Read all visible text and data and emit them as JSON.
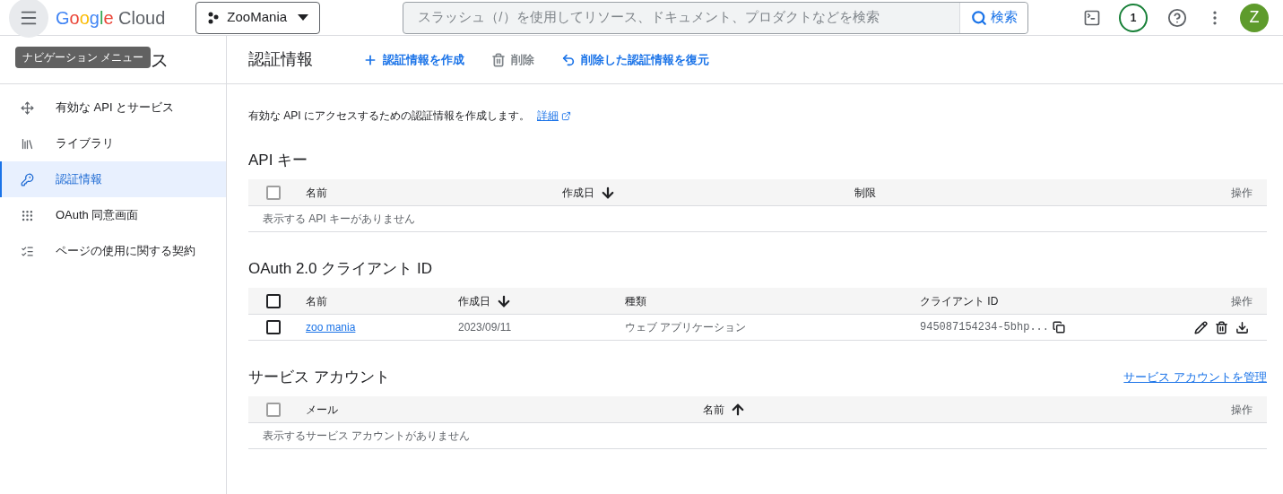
{
  "topbar": {
    "product_name": "Google Cloud",
    "project": "ZooMania",
    "search": {
      "placeholder": "スラッシュ（/）を使用してリソース、ドキュメント、プロダクトなどを検索",
      "button": "検索"
    },
    "notifications": "1",
    "avatar": "Z"
  },
  "tooltip": "ナビゲーション メニュー",
  "sidebar": {
    "title_fragment": "ス",
    "items": [
      {
        "label": "有効な API とサービス",
        "selected": false
      },
      {
        "label": "ライブラリ",
        "selected": false
      },
      {
        "label": "認証情報",
        "selected": true
      },
      {
        "label": "OAuth 同意画面",
        "selected": false
      },
      {
        "label": "ページの使用に関する契約",
        "selected": false
      }
    ]
  },
  "toolbar": {
    "title": "認証情報",
    "actions": [
      {
        "label": "認証情報を作成",
        "disabled": false
      },
      {
        "label": "削除",
        "disabled": true
      },
      {
        "label": "削除した認証情報を復元",
        "disabled": false
      }
    ]
  },
  "intro": {
    "text": "有効な API にアクセスするための認証情報を作成します。",
    "link": "詳細"
  },
  "sections": [
    {
      "title": "API キー",
      "select_all": {
        "checked": false,
        "disabled": true
      },
      "columns": [
        {
          "label": "名前"
        },
        {
          "label": "作成日",
          "sorted": true,
          "descending": true
        },
        {
          "label": "制限"
        }
      ],
      "actions_label": "操作",
      "empty": "表示する API キーがありません"
    },
    {
      "title": "OAuth 2.0 クライアント ID",
      "select_all": {
        "checked": false,
        "disabled": false
      },
      "columns": [
        {
          "label": "名前"
        },
        {
          "label": "作成日",
          "sorted": true,
          "descending": true
        },
        {
          "label": "種類"
        },
        {
          "label": "クライアント ID"
        }
      ],
      "actions_label": "操作",
      "rows": [
        {
          "checked": false,
          "name": "zoo mania",
          "created": "2023/09/11",
          "type": "ウェブ アプリケーション",
          "client_id": "945087154234-5bhp..."
        }
      ]
    },
    {
      "title": "サービス アカウント",
      "link": "サービス アカウントを管理",
      "select_all": {
        "checked": false,
        "disabled": true
      },
      "columns": [
        {
          "label": "メール"
        },
        {
          "label": "名前",
          "sorted": true,
          "descending": false
        }
      ],
      "actions_label": "操作",
      "empty": "表示するサービス アカウントがありません"
    }
  ]
}
